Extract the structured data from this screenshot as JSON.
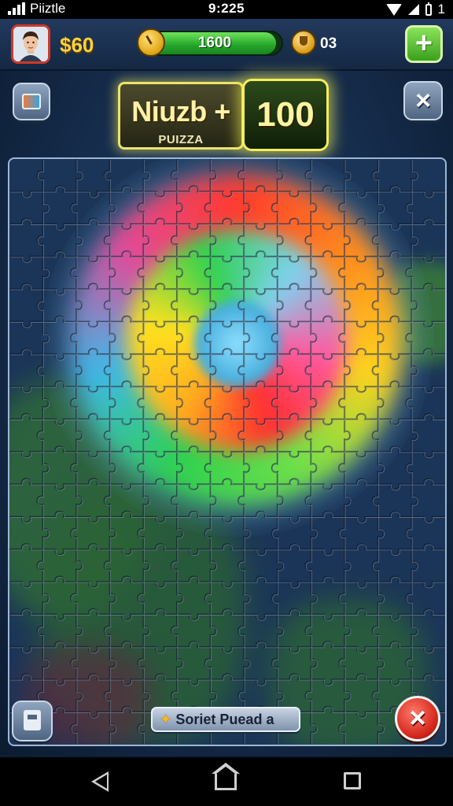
{
  "status_bar": {
    "app_name": "Piiztle",
    "time": "9:225",
    "battery_text": "1"
  },
  "hud": {
    "coins": "$60",
    "energy_value": "1600",
    "energy_fill_fraction": 0.96,
    "trophies": "03",
    "add_label": "+"
  },
  "puzzle": {
    "title": "Niuzb +",
    "subtitle": "PUIZZA",
    "score": "100",
    "close_label": "×",
    "hint_label": "Soriet  Puead a",
    "hint_icon": "star-icon",
    "exit_label": "×",
    "colors": {
      "highlight": "#f4ee5a",
      "exit_red": "#d4261c",
      "energy_green": "#24a52a"
    }
  },
  "icons": {
    "profile": "avatar",
    "clock": "clock-icon",
    "trophy": "trophy-icon",
    "menu": "image-menu-icon",
    "piece_tray": "piece-tray-icon"
  }
}
